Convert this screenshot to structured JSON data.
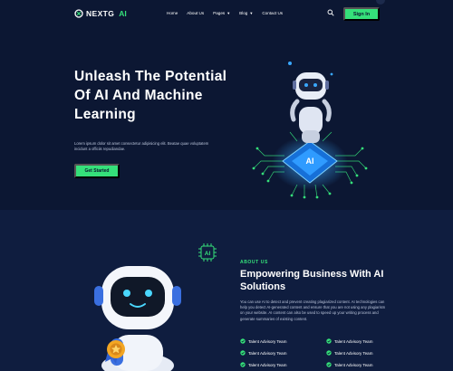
{
  "brand": {
    "name": "NEXTG",
    "accent": "AI"
  },
  "nav": {
    "items": [
      {
        "label": "Home",
        "dropdown": false
      },
      {
        "label": "About Us",
        "dropdown": false
      },
      {
        "label": "Pages",
        "dropdown": true
      },
      {
        "label": "Blog",
        "dropdown": true
      },
      {
        "label": "Contact Us",
        "dropdown": false
      }
    ]
  },
  "header": {
    "signin_label": "Sign In"
  },
  "hero": {
    "title": "Unleash The Potential Of AI And Machine Learning",
    "description": "Lorem ipsum dolor sit amet consectetur adipisicing elit. Beatae quae voluptatem incidunt a officiis repudiandae.",
    "cta_label": "Get Started",
    "chip_label": "AI"
  },
  "about": {
    "chip_label": "AI",
    "label": "ABOUT US",
    "title": "Empowering Business With AI Solutions",
    "description": "You can use AI to detect and prevent creating plagiarized content. AI technologies can help you detect AI-generated content and ensure that you are not using any plagiarism on your website. AI content can also be used to speed up your writing process and generate summaries of existing content.",
    "features": [
      "Talent Advisory Team",
      "Talent Advisory Team",
      "Talent Advisory Team",
      "Talent Advisory Team",
      "Talent Advisory Team",
      "Talent Advisory Team"
    ]
  },
  "colors": {
    "accent": "#35e07a",
    "background": "#0b1530",
    "section": "#0f1d3f",
    "chip_glow": "#3aa8ff"
  }
}
